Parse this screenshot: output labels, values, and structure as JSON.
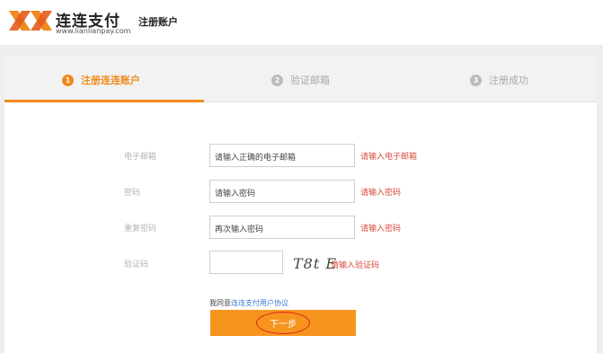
{
  "header": {
    "brand_name": "连连支付",
    "brand_url": "www.lianlianpay.com",
    "title": "注册账户"
  },
  "steps": [
    {
      "num": "1",
      "label": "注册连连账户",
      "state": "active"
    },
    {
      "num": "2",
      "label": "验证邮箱",
      "state": "inactive"
    },
    {
      "num": "3",
      "label": "注册成功",
      "state": "inactive"
    }
  ],
  "form": {
    "email": {
      "label": "电子邮箱",
      "placeholder": "请输入正确的电子邮箱",
      "error": "请输入电子邮箱"
    },
    "password": {
      "label": "密码",
      "placeholder": "请输入密码",
      "error": "请输入密码"
    },
    "confirm": {
      "label": "重复密码",
      "placeholder": "再次输入密码",
      "error": "请输入密码"
    },
    "captcha": {
      "label": "验证码",
      "value": "",
      "image_text": "T8t E",
      "error": "请输入验证码"
    },
    "agree_prefix": "我同意",
    "agree_link": "连连支付用户协议",
    "next_label": "下一步"
  },
  "colors": {
    "accent": "#f08a1c",
    "button": "#f7941e",
    "error": "#d94a3c",
    "link": "#3a7bd5"
  }
}
